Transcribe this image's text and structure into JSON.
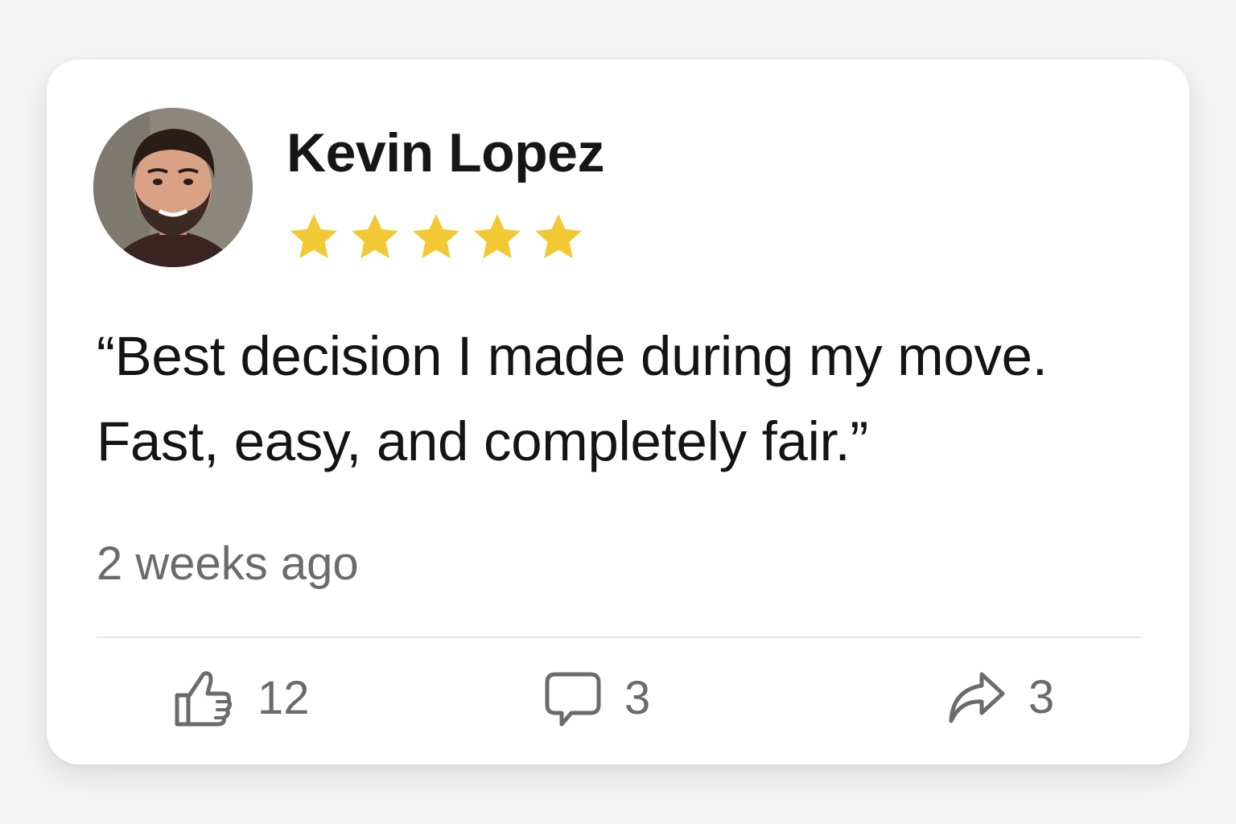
{
  "review": {
    "author_name": "Kevin Lopez",
    "rating": 5,
    "rating_max": 5,
    "quote": "“Best decision I made during my move. Fast, easy, and completely fair.”",
    "timestamp": "2 weeks ago"
  },
  "actions": {
    "like_count": "12",
    "comment_count": "3",
    "share_count": "3"
  },
  "icons": {
    "star": "star-icon",
    "like": "thumbs-up-icon",
    "comment": "speech-bubble-icon",
    "share": "share-arrow-icon"
  },
  "colors": {
    "star": "#F2C935",
    "text_primary": "#141414",
    "text_secondary": "#6B6B6B",
    "card_background": "#FFFFFF",
    "page_background": "#F4F4F4"
  }
}
